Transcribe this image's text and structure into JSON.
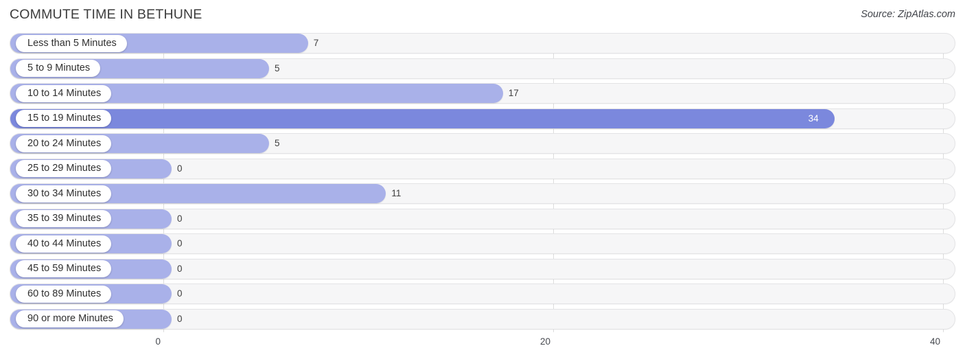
{
  "header": {
    "title": "COMMUTE TIME IN BETHUNE",
    "source": "Source: ZipAtlas.com"
  },
  "chart_data": {
    "type": "bar",
    "orientation": "horizontal",
    "title": "COMMUTE TIME IN BETHUNE",
    "xlabel": "",
    "ylabel": "",
    "xlim": [
      0,
      40
    ],
    "xticks": [
      "0",
      "20",
      "40"
    ],
    "xtick_values": [
      0,
      20,
      40
    ],
    "grid": true,
    "legend": null,
    "categories": [
      "Less than 5 Minutes",
      "5 to 9 Minutes",
      "10 to 14 Minutes",
      "15 to 19 Minutes",
      "20 to 24 Minutes",
      "25 to 29 Minutes",
      "30 to 34 Minutes",
      "35 to 39 Minutes",
      "40 to 44 Minutes",
      "45 to 59 Minutes",
      "60 to 89 Minutes",
      "90 or more Minutes"
    ],
    "values": [
      7,
      5,
      17,
      34,
      5,
      0,
      11,
      0,
      0,
      0,
      0,
      0
    ],
    "value_labels": [
      "7",
      "5",
      "17",
      "34",
      "5",
      "0",
      "11",
      "0",
      "0",
      "0",
      "0",
      "0"
    ],
    "highlight_index": 3,
    "colors": {
      "bar": "#a9b1e9",
      "bar_highlight": "#7b88dd",
      "track": "#f6f6f7",
      "track_border": "#e3e3e5",
      "gridline": "#dddddd",
      "label_pill": "#ffffff",
      "text": "#3a3a3a"
    }
  }
}
